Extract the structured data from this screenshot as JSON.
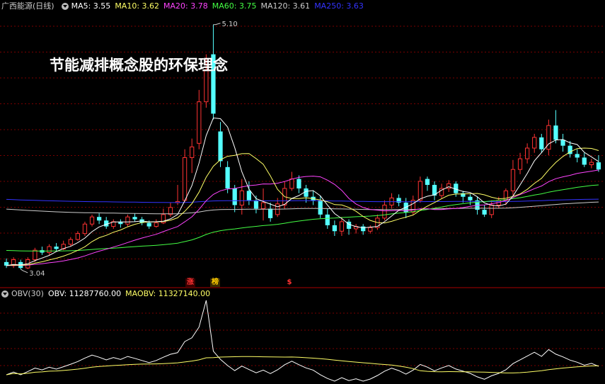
{
  "window_title": "广西能源(日线)",
  "headline": "节能减排概念股的环保理念",
  "ma_legend": [
    {
      "label": "MA5: 3.55",
      "color": "#ffffff"
    },
    {
      "label": "MA10: 3.62",
      "color": "#ffff66"
    },
    {
      "label": "MA20: 3.78",
      "color": "#ff44ff"
    },
    {
      "label": "MA60: 3.75",
      "color": "#44ff44"
    },
    {
      "label": "MA120: 3.61",
      "color": "#cccccc"
    },
    {
      "label": "MA250: 3.63",
      "color": "#3333ff"
    }
  ],
  "obv_legend": {
    "name": "OBV(30)",
    "obv": "OBV: 11287760.00",
    "maobv": "MAOBV: 11327140.00"
  },
  "tags": [
    {
      "text": "涨",
      "color": "#ff3333"
    },
    {
      "text": "榜",
      "color": "#ffcc00"
    },
    {
      "text": "$",
      "color": "#ff3333"
    }
  ],
  "colors": {
    "up": "#ff3333",
    "down": "#54ffff",
    "grid": "#7a0000"
  },
  "chart_data": {
    "type": "candlestick",
    "high_label": "5.10",
    "low_label": "3.04",
    "y_range": [
      2.95,
      5.2
    ],
    "candles": [
      [
        3.1,
        3.07,
        3.13,
        3.05
      ],
      [
        3.07,
        3.12,
        3.14,
        3.05
      ],
      [
        3.1,
        3.05,
        3.12,
        3.04
      ],
      [
        3.05,
        3.12,
        3.14,
        3.04
      ],
      [
        3.12,
        3.2,
        3.22,
        3.1
      ],
      [
        3.2,
        3.18,
        3.23,
        3.16
      ],
      [
        3.18,
        3.23,
        3.25,
        3.16
      ],
      [
        3.23,
        3.21,
        3.26,
        3.19
      ],
      [
        3.21,
        3.25,
        3.28,
        3.2
      ],
      [
        3.25,
        3.29,
        3.31,
        3.23
      ],
      [
        3.29,
        3.34,
        3.36,
        3.28
      ],
      [
        3.34,
        3.42,
        3.44,
        3.32
      ],
      [
        3.42,
        3.48,
        3.5,
        3.4
      ],
      [
        3.48,
        3.45,
        3.51,
        3.42
      ],
      [
        3.45,
        3.4,
        3.48,
        3.38
      ],
      [
        3.4,
        3.44,
        3.46,
        3.38
      ],
      [
        3.44,
        3.42,
        3.46,
        3.39
      ],
      [
        3.42,
        3.48,
        3.5,
        3.4
      ],
      [
        3.48,
        3.46,
        3.51,
        3.44
      ],
      [
        3.46,
        3.43,
        3.48,
        3.41
      ],
      [
        3.43,
        3.4,
        3.45,
        3.38
      ],
      [
        3.4,
        3.43,
        3.46,
        3.39
      ],
      [
        3.43,
        3.5,
        3.55,
        3.42
      ],
      [
        3.5,
        3.56,
        3.6,
        3.48
      ],
      [
        3.6,
        3.61,
        3.75,
        3.58
      ],
      [
        3.62,
        3.98,
        4.05,
        3.6
      ],
      [
        3.98,
        4.07,
        4.14,
        3.85
      ],
      [
        4.1,
        4.45,
        4.55,
        4.05
      ],
      [
        4.45,
        4.72,
        4.85,
        4.4
      ],
      [
        4.85,
        4.35,
        5.1,
        4.3
      ],
      [
        4.2,
        3.95,
        4.28,
        3.9
      ],
      [
        3.9,
        3.72,
        3.95,
        3.68
      ],
      [
        3.72,
        3.58,
        3.75,
        3.52
      ],
      [
        3.58,
        3.7,
        3.8,
        3.5
      ],
      [
        3.7,
        3.62,
        3.78,
        3.58
      ],
      [
        3.62,
        3.55,
        3.66,
        3.51
      ],
      [
        3.55,
        3.6,
        3.72,
        3.45
      ],
      [
        3.55,
        3.47,
        3.6,
        3.44
      ],
      [
        3.5,
        3.59,
        3.64,
        3.48
      ],
      [
        3.58,
        3.72,
        3.78,
        3.55
      ],
      [
        3.72,
        3.8,
        3.86,
        3.7
      ],
      [
        3.8,
        3.72,
        3.83,
        3.68
      ],
      [
        3.72,
        3.65,
        3.75,
        3.6
      ],
      [
        3.65,
        3.62,
        3.7,
        3.58
      ],
      [
        3.62,
        3.5,
        3.66,
        3.47
      ],
      [
        3.5,
        3.41,
        3.55,
        3.38
      ],
      [
        3.41,
        3.36,
        3.45,
        3.32
      ],
      [
        3.36,
        3.44,
        3.48,
        3.32
      ],
      [
        3.44,
        3.38,
        3.46,
        3.33
      ],
      [
        3.38,
        3.4,
        3.42,
        3.34
      ],
      [
        3.4,
        3.36,
        3.42,
        3.33
      ],
      [
        3.36,
        3.39,
        3.41,
        3.34
      ],
      [
        3.39,
        3.47,
        3.5,
        3.37
      ],
      [
        3.47,
        3.58,
        3.62,
        3.45
      ],
      [
        3.58,
        3.64,
        3.68,
        3.55
      ],
      [
        3.64,
        3.6,
        3.67,
        3.57
      ],
      [
        3.6,
        3.52,
        3.64,
        3.47
      ],
      [
        3.52,
        3.62,
        3.66,
        3.5
      ],
      [
        3.62,
        3.78,
        3.82,
        3.6
      ],
      [
        3.8,
        3.75,
        3.82,
        3.7
      ],
      [
        3.75,
        3.66,
        3.78,
        3.62
      ],
      [
        3.66,
        3.72,
        3.76,
        3.63
      ],
      [
        3.72,
        3.76,
        3.79,
        3.69
      ],
      [
        3.76,
        3.68,
        3.78,
        3.65
      ],
      [
        3.68,
        3.65,
        3.7,
        3.6
      ],
      [
        3.65,
        3.62,
        3.67,
        3.58
      ],
      [
        3.62,
        3.54,
        3.65,
        3.5
      ],
      [
        3.54,
        3.5,
        3.58,
        3.48
      ],
      [
        3.5,
        3.58,
        3.62,
        3.47
      ],
      [
        3.58,
        3.62,
        3.65,
        3.55
      ],
      [
        3.62,
        3.7,
        3.72,
        3.58
      ],
      [
        3.7,
        3.88,
        3.96,
        3.66
      ],
      [
        3.88,
        3.97,
        4.02,
        3.84
      ],
      [
        3.97,
        4.06,
        4.1,
        3.93
      ],
      [
        4.06,
        4.15,
        4.18,
        4.02
      ],
      [
        4.15,
        4.05,
        4.18,
        4.02
      ],
      [
        4.05,
        4.25,
        4.3,
        4.0
      ],
      [
        4.25,
        4.13,
        4.38,
        4.1
      ],
      [
        4.13,
        4.08,
        4.18,
        4.03
      ],
      [
        4.08,
        4.01,
        4.12,
        3.98
      ],
      [
        4.01,
        3.98,
        4.05,
        3.94
      ],
      [
        3.98,
        3.92,
        4.02,
        3.9
      ],
      [
        3.92,
        3.94,
        3.97,
        3.89
      ],
      [
        3.94,
        3.88,
        4.0,
        3.86
      ]
    ],
    "obv_label": "OBV: 11287760.00",
    "maobv_label": "MAOBV: 11327140.00"
  }
}
